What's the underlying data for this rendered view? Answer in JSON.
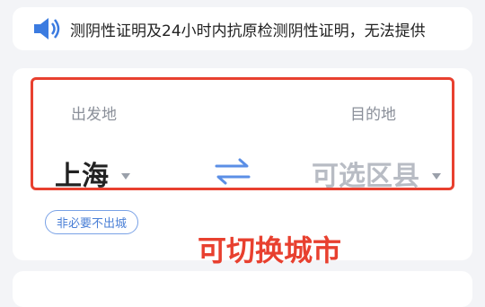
{
  "notice": {
    "icon": "speaker-icon",
    "text": "测阴性证明及24小时内抗原检测阴性证明，无法提供"
  },
  "route": {
    "from_label": "出发地",
    "to_label": "目的地",
    "from_city": "上海",
    "to_city": "可选区县",
    "swap_icon": "swap-arrows-icon",
    "chip": "非必要不出城"
  },
  "annotation": "可切换城市",
  "colors": {
    "accent": "#4a7fd6",
    "highlight": "#e8402f"
  }
}
